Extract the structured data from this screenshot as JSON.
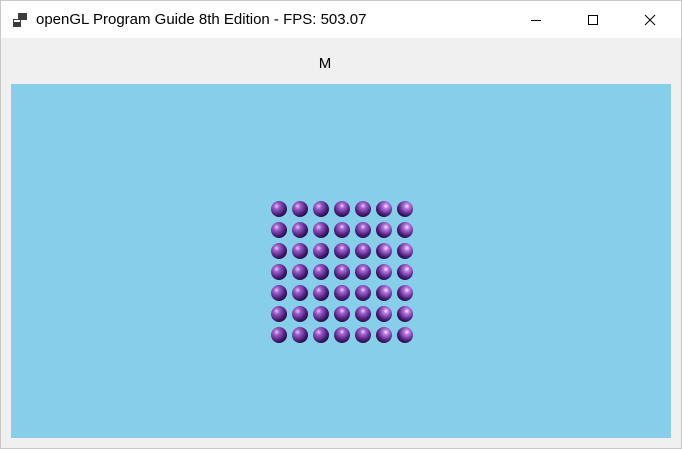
{
  "window": {
    "title": "openGL Program Guide 8th Edition - FPS: 503.07",
    "icon": "app-window-icon",
    "controls": {
      "minimize_icon": "minimize-icon",
      "maximize_icon": "maximize-icon",
      "close_icon": "close-icon"
    }
  },
  "toolbar": {
    "label": "M"
  },
  "canvas": {
    "background_color": "#87ceeb",
    "scene": {
      "object": "sphere-grid",
      "rows": 7,
      "columns": 7,
      "sphere_base_color": "#4b1f7a",
      "sphere_highlight_color": "#f3d9ff"
    }
  }
}
